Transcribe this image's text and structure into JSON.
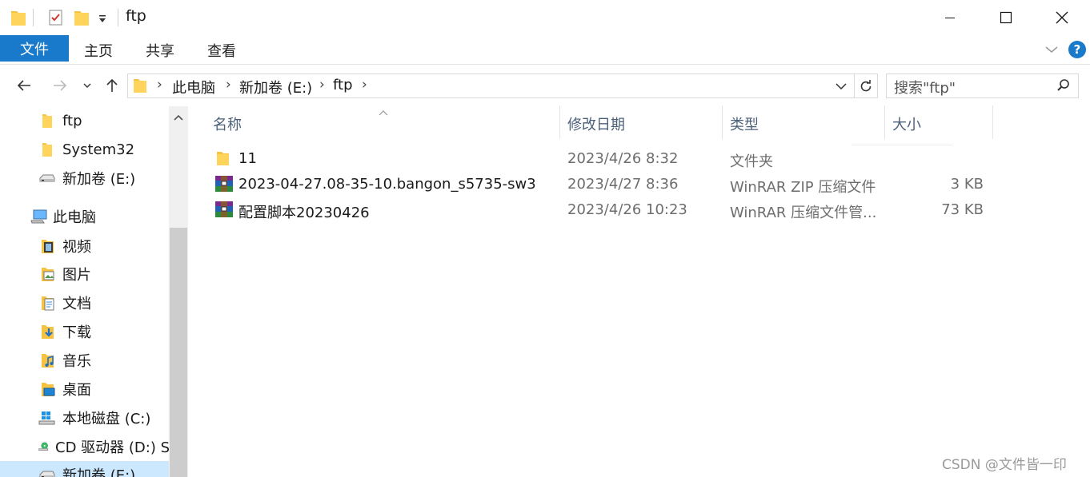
{
  "title_bar": {
    "title": "ftp",
    "window_buttons": [
      "minimize",
      "maximize",
      "close"
    ]
  },
  "ribbon": {
    "file_tab": "文件",
    "tabs": [
      "主页",
      "共享",
      "查看"
    ],
    "help_label": "?"
  },
  "address": {
    "crumbs": [
      "此电脑",
      "新加卷 (E:)",
      "ftp"
    ],
    "search_placeholder": "搜索\"ftp\""
  },
  "navigation": {
    "items": [
      {
        "label": "ftp",
        "icon": "folder-icon"
      },
      {
        "label": "System32",
        "icon": "folder-icon"
      },
      {
        "label": "新加卷 (E:)",
        "icon": "drive-icon"
      },
      {
        "label": "此电脑",
        "icon": "computer-icon"
      },
      {
        "label": "视频",
        "icon": "videos-folder-icon"
      },
      {
        "label": "图片",
        "icon": "pictures-folder-icon"
      },
      {
        "label": "文档",
        "icon": "documents-folder-icon"
      },
      {
        "label": "下载",
        "icon": "downloads-folder-icon"
      },
      {
        "label": "音乐",
        "icon": "music-folder-icon"
      },
      {
        "label": "桌面",
        "icon": "desktop-folder-icon"
      },
      {
        "label": "本地磁盘 (C:)",
        "icon": "windows-drive-icon"
      },
      {
        "label": "CD 驱动器 (D:) S",
        "icon": "cd-drive-icon"
      },
      {
        "label": "新加卷 (E:)",
        "icon": "drive-icon",
        "selected": true
      }
    ]
  },
  "file_list": {
    "columns": [
      "名称",
      "修改日期",
      "类型",
      "大小"
    ],
    "rows": [
      {
        "name": "11",
        "date": "2023/4/26 8:32",
        "type": "文件夹",
        "size": "",
        "icon": "folder-icon"
      },
      {
        "name": "2023-04-27.08-35-10.bangon_s5735-sw3",
        "date": "2023/4/27 8:36",
        "type": "WinRAR ZIP 压缩文件",
        "size": "3 KB",
        "icon": "winrar-archive-icon"
      },
      {
        "name": "配置脚本20230426",
        "date": "2023/4/26 10:23",
        "type": "WinRAR 压缩文件管...",
        "size": "73 KB",
        "icon": "winrar-archive-icon"
      }
    ]
  },
  "watermark": "CSDN @文件皆一印",
  "colors": {
    "accent": "#1979ca",
    "folder": "#f5c242",
    "selection": "#cce8ff",
    "header_text": "#4c607a"
  }
}
